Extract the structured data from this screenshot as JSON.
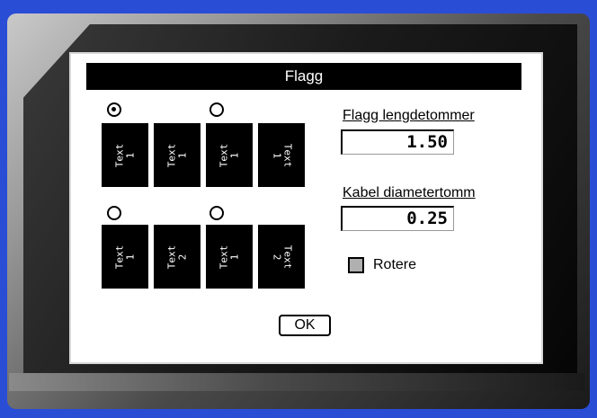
{
  "dialog": {
    "title": "Flagg",
    "ok_label": "OK"
  },
  "layouts": [
    {
      "selected": true,
      "tags": [
        {
          "text": "Text\n1",
          "rotation": "left"
        },
        {
          "text": "Text\n1",
          "rotation": "left"
        }
      ]
    },
    {
      "selected": false,
      "tags": [
        {
          "text": "Text\n1",
          "rotation": "left"
        },
        {
          "text": "Text\n1",
          "rotation": "right"
        }
      ]
    },
    {
      "selected": false,
      "tags": [
        {
          "text": "Text\n1",
          "rotation": "left"
        },
        {
          "text": "Text\n2",
          "rotation": "left"
        }
      ]
    },
    {
      "selected": false,
      "tags": [
        {
          "text": "Text\n1",
          "rotation": "left"
        },
        {
          "text": "Text\n2",
          "rotation": "right"
        }
      ]
    }
  ],
  "fields": {
    "flag_length": {
      "label": "Flagg lengdetommer",
      "value": "1.50"
    },
    "cable_diameter": {
      "label": "Kabel diametertomm",
      "value": "0.25"
    }
  },
  "rotate": {
    "label": "Rotere",
    "checked": false
  }
}
